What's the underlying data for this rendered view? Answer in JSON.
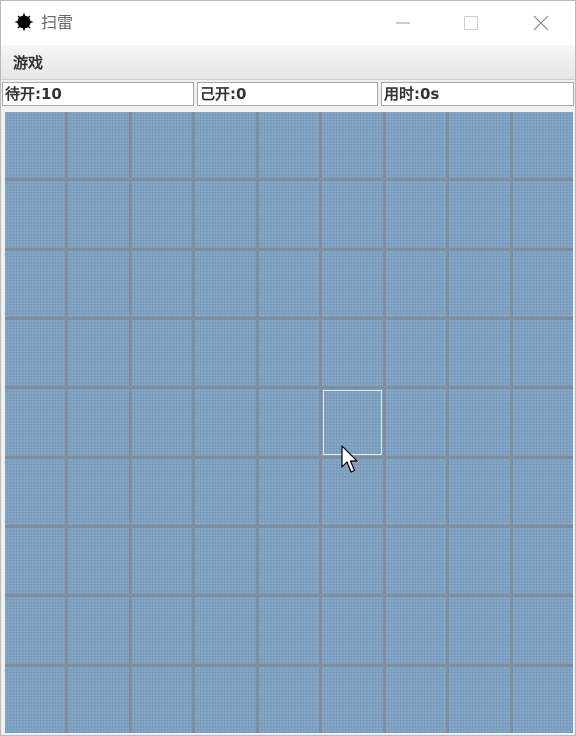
{
  "window": {
    "title": "扫雷",
    "icon": "mine-icon",
    "controls": [
      "minimize-icon",
      "maximize-icon",
      "close-icon"
    ]
  },
  "menu": {
    "items": [
      {
        "label": "游戏"
      }
    ]
  },
  "status": {
    "pending_label": "待开:",
    "pending_value": "10",
    "opened_label": "己开:",
    "opened_value": "0",
    "time_label": "用时:",
    "time_value": "0s"
  },
  "board": {
    "rows": 9,
    "cols": 9,
    "hovered_cell": {
      "row": 4,
      "col": 5
    },
    "colors": {
      "cell": "#7fa2c4",
      "grid": "#7f8f9f"
    }
  }
}
